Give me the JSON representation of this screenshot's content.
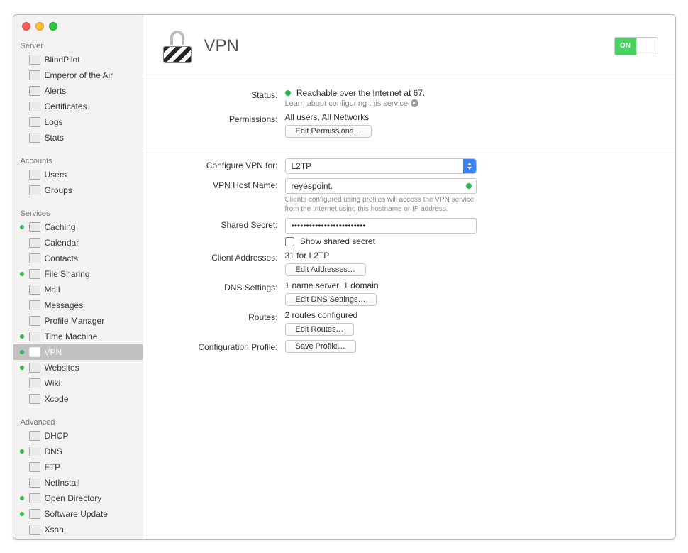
{
  "window": {
    "title": "VPN",
    "toggle_label": "ON"
  },
  "sidebar": {
    "server_header": "Server",
    "server": [
      {
        "label": "BlindPilot"
      },
      {
        "label": "Emperor of the Air"
      },
      {
        "label": "Alerts"
      },
      {
        "label": "Certificates"
      },
      {
        "label": "Logs"
      },
      {
        "label": "Stats"
      }
    ],
    "accounts_header": "Accounts",
    "accounts": [
      {
        "label": "Users"
      },
      {
        "label": "Groups"
      }
    ],
    "services_header": "Services",
    "services": [
      {
        "label": "Caching",
        "on": true
      },
      {
        "label": "Calendar",
        "on": false
      },
      {
        "label": "Contacts",
        "on": false
      },
      {
        "label": "File Sharing",
        "on": true
      },
      {
        "label": "Mail",
        "on": false
      },
      {
        "label": "Messages",
        "on": false
      },
      {
        "label": "Profile Manager",
        "on": false
      },
      {
        "label": "Time Machine",
        "on": true
      },
      {
        "label": "VPN",
        "on": true,
        "selected": true
      },
      {
        "label": "Websites",
        "on": true
      },
      {
        "label": "Wiki",
        "on": false
      },
      {
        "label": "Xcode",
        "on": false
      }
    ],
    "advanced_header": "Advanced",
    "advanced": [
      {
        "label": "DHCP",
        "on": false
      },
      {
        "label": "DNS",
        "on": true
      },
      {
        "label": "FTP",
        "on": false
      },
      {
        "label": "NetInstall",
        "on": false
      },
      {
        "label": "Open Directory",
        "on": true
      },
      {
        "label": "Software Update",
        "on": true
      },
      {
        "label": "Xsan",
        "on": false
      }
    ]
  },
  "labels": {
    "status": "Status:",
    "permissions": "Permissions:",
    "configure": "Configure VPN for:",
    "hostname": "VPN Host Name:",
    "secret": "Shared Secret:",
    "client_addr": "Client Addresses:",
    "dns": "DNS Settings:",
    "routes": "Routes:",
    "profile": "Configuration Profile:"
  },
  "values": {
    "status": "Reachable over the Internet at 67.",
    "learn": "Learn about configuring this service",
    "permissions": "All users, All Networks",
    "edit_permissions_btn": "Edit Permissions…",
    "protocol": "L2TP",
    "hostname": "reyespoint.",
    "hostname_hint": "Clients configured using profiles will access the VPN service from the Internet using this hostname or IP address.",
    "secret": "•••••••••••••••••••••••••",
    "show_secret": "Show shared secret",
    "client_addr": "31 for L2TP",
    "edit_addresses_btn": "Edit Addresses…",
    "dns": "1 name server, 1 domain",
    "edit_dns_btn": "Edit DNS Settings…",
    "routes": "2 routes configured",
    "edit_routes_btn": "Edit Routes…",
    "save_profile_btn": "Save Profile…"
  }
}
